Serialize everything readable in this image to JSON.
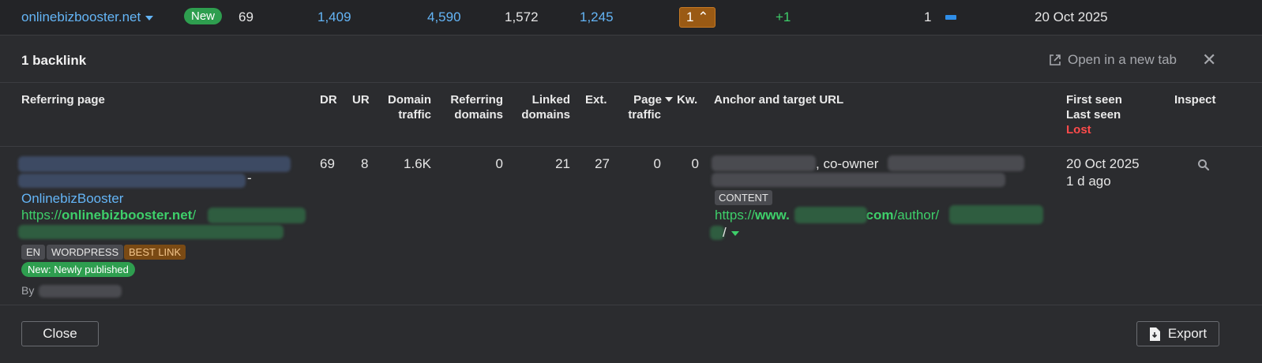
{
  "top_row": {
    "domain": "onlinebizbooster.net",
    "badge": "New",
    "dr": "69",
    "c1": "1,409",
    "c2": "4,590",
    "c3": "1,572",
    "c4": "1,245",
    "links_badge": "1",
    "change": "+1",
    "count": "1",
    "date": "20 Oct 2025"
  },
  "panel": {
    "title": "1 backlink",
    "open_new_tab": "Open in a new tab",
    "close_icon": "✕"
  },
  "columns": {
    "referring_page": "Referring page",
    "dr": "DR",
    "ur": "UR",
    "domain_traffic_1": "Domain",
    "domain_traffic_2": "traffic",
    "referring_domains_1": "Referring",
    "referring_domains_2": "domains",
    "linked_domains_1": "Linked",
    "linked_domains_2": "domains",
    "ext": "Ext.",
    "page_traffic_1": "Page",
    "page_traffic_2": "traffic",
    "kw": "Kw.",
    "anchor": "Anchor and target URL",
    "first_seen": "First seen",
    "last_seen": "Last seen",
    "lost": "Lost",
    "inspect": "Inspect"
  },
  "row": {
    "dash": "-",
    "site_name": "OnlinebizBooster",
    "url_prefix": "https://",
    "url_domain": "onlinebizbooster.net",
    "url_tail": "/",
    "tags": [
      "EN",
      "WORDPRESS",
      "BEST LINK"
    ],
    "new_tag": "New: Newly published",
    "by": "By",
    "dr": "69",
    "ur": "8",
    "domain_traffic": "1.6K",
    "referring_domains": "0",
    "linked_domains": "21",
    "ext": "27",
    "page_traffic": "0",
    "kw": "0",
    "anchor_text": ", co-owner",
    "content_tag": "CONTENT",
    "target_prefix": "https://",
    "target_www": "www.",
    "target_com": ".com",
    "target_path": "/author/",
    "target_tail": "/",
    "first_seen": "20 Oct 2025",
    "last_seen": "1 d ago"
  },
  "footer": {
    "close": "Close",
    "export": "Export"
  },
  "icons": {
    "external": "external-link-icon",
    "close": "close-icon",
    "search": "search-icon",
    "export": "export-file-icon"
  }
}
